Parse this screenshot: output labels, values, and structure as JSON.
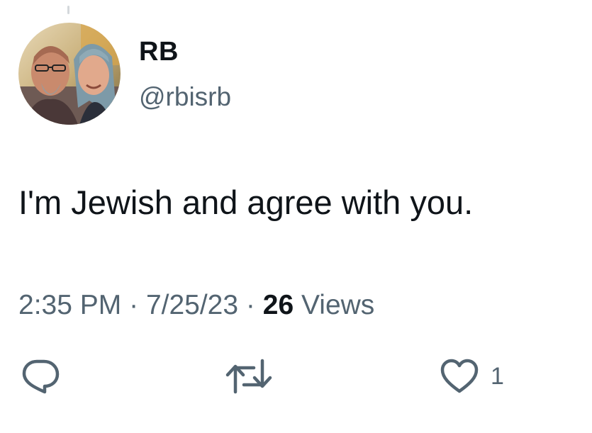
{
  "tweet": {
    "author": {
      "display_name": "RB",
      "handle": "@rbisrb",
      "avatar_alt": "avatar"
    },
    "text": "I'm Jewish and agree with you.",
    "meta": {
      "time": "2:35 PM",
      "separator": "·",
      "date": "7/25/23",
      "views_count": "26",
      "views_label": "Views"
    },
    "actions": {
      "reply_icon": "reply-bubble-icon",
      "retweet_icon": "retweet-icon",
      "like_icon": "heart-icon",
      "like_count": "1"
    }
  },
  "colors": {
    "primary_text": "#0f1419",
    "secondary_text": "#536471",
    "background": "#ffffff"
  }
}
